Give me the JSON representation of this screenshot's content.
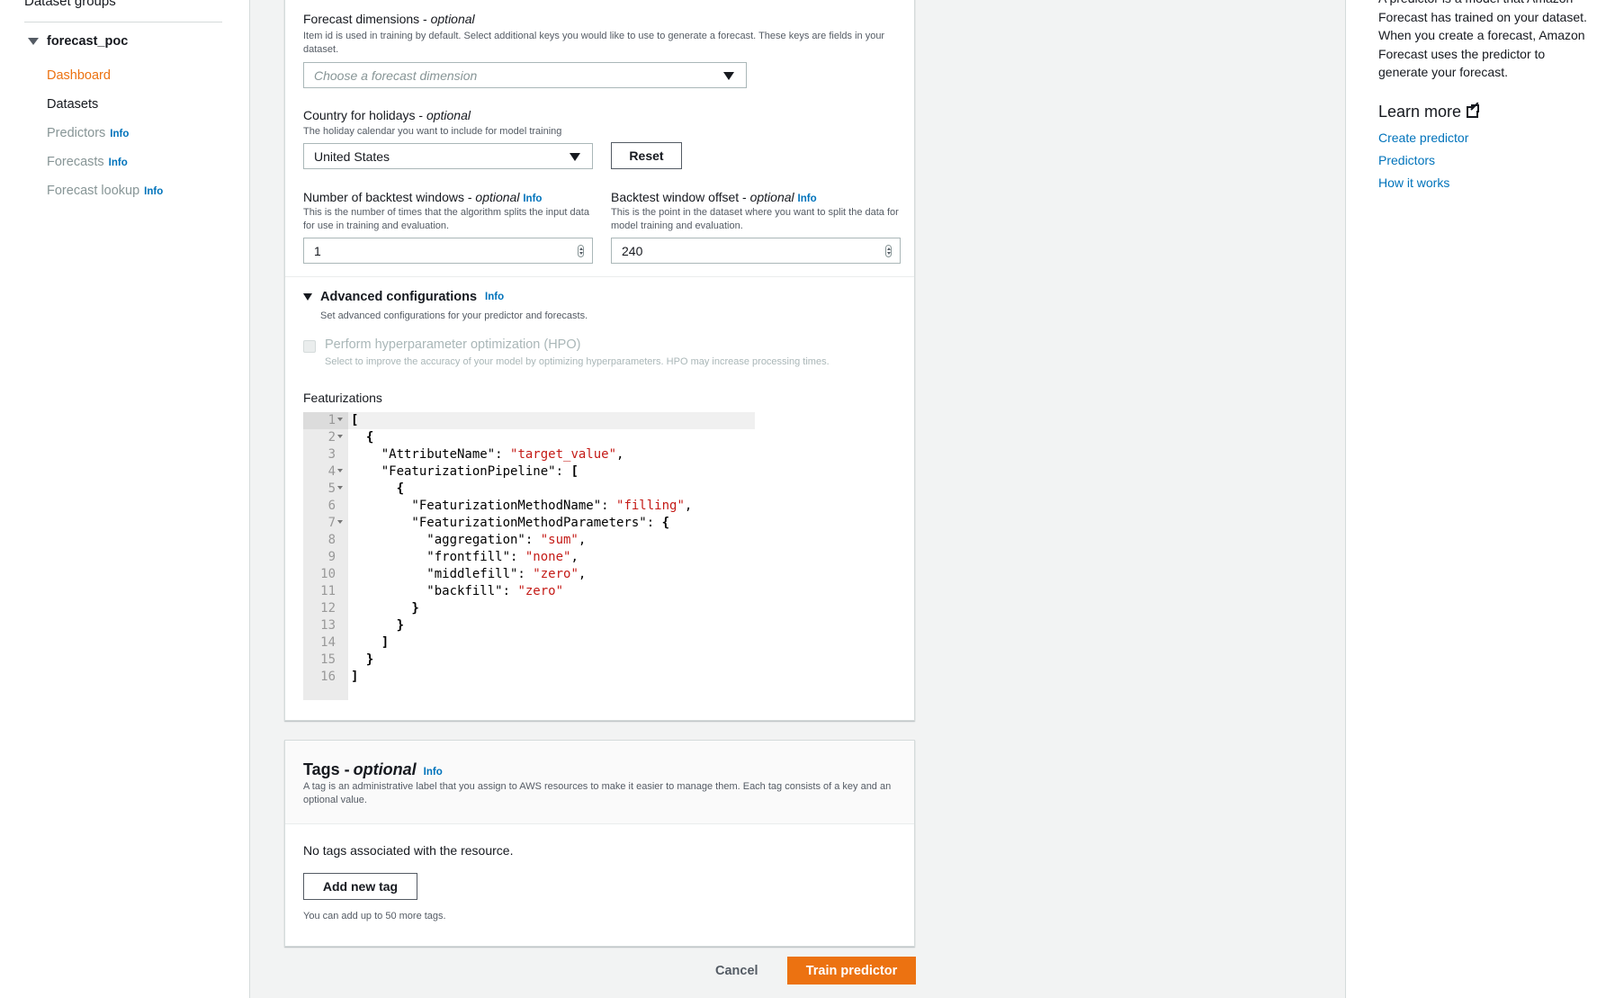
{
  "nav": {
    "heading": "Dataset groups",
    "group_label": "forecast_poc",
    "items": [
      {
        "label": "Dashboard"
      },
      {
        "label": "Datasets"
      },
      {
        "label": "Predictors",
        "info": "Info"
      },
      {
        "label": "Forecasts",
        "info": "Info"
      },
      {
        "label": "Forecast lookup",
        "info": "Info"
      }
    ]
  },
  "form": {
    "dimensions": {
      "label": "Forecast dimensions - ",
      "optional": "optional",
      "description": "Item id is used in training by default. Select additional keys you would like to use to generate a forecast. These keys are fields in your dataset.",
      "placeholder": "Choose a forecast dimension"
    },
    "holidays": {
      "label": "Country for holidays - ",
      "optional": "optional",
      "description": "The holiday calendar you want to include for model training",
      "value": "United States",
      "reset_label": "Reset"
    },
    "backtest_windows": {
      "label": "Number of backtest windows - ",
      "optional": "optional",
      "info": "Info",
      "description": "This is the number of times that the algorithm splits the input data for use in training and evaluation.",
      "value": "1"
    },
    "backtest_offset": {
      "label": "Backtest window offset - ",
      "optional": "optional",
      "info": "Info",
      "description": "This is the point in the dataset where you want to split the data for model training and evaluation.",
      "value": "240"
    },
    "advanced": {
      "title": "Advanced configurations",
      "info": "Info",
      "description": "Set advanced configurations for your predictor and forecasts.",
      "hpo_label": "Perform hyperparameter optimization (HPO)",
      "hpo_description": "Select to improve the accuracy of your model by optimizing hyperparameters. HPO may increase processing times."
    },
    "featurizations": {
      "label": "Featurizations",
      "lines": [
        {
          "n": "1",
          "fold": true,
          "parts": [
            {
              "t": "p",
              "v": "["
            }
          ]
        },
        {
          "n": "2",
          "fold": true,
          "parts": [
            {
              "t": "p",
              "v": "  {"
            }
          ]
        },
        {
          "n": "3",
          "fold": false,
          "parts": [
            {
              "t": "k",
              "v": "    \"AttributeName\": "
            },
            {
              "t": "s",
              "v": "\"target_value\""
            },
            {
              "t": "k",
              "v": ","
            }
          ]
        },
        {
          "n": "4",
          "fold": true,
          "parts": [
            {
              "t": "k",
              "v": "    \"FeaturizationPipeline\": "
            },
            {
              "t": "p",
              "v": "["
            }
          ]
        },
        {
          "n": "5",
          "fold": true,
          "parts": [
            {
              "t": "p",
              "v": "      {"
            }
          ]
        },
        {
          "n": "6",
          "fold": false,
          "parts": [
            {
              "t": "k",
              "v": "        \"FeaturizationMethodName\": "
            },
            {
              "t": "s",
              "v": "\"filling\""
            },
            {
              "t": "k",
              "v": ","
            }
          ]
        },
        {
          "n": "7",
          "fold": true,
          "parts": [
            {
              "t": "k",
              "v": "        \"FeaturizationMethodParameters\": "
            },
            {
              "t": "p",
              "v": "{"
            }
          ]
        },
        {
          "n": "8",
          "fold": false,
          "parts": [
            {
              "t": "k",
              "v": "          \"aggregation\": "
            },
            {
              "t": "s",
              "v": "\"sum\""
            },
            {
              "t": "k",
              "v": ","
            }
          ]
        },
        {
          "n": "9",
          "fold": false,
          "parts": [
            {
              "t": "k",
              "v": "          \"frontfill\": "
            },
            {
              "t": "s",
              "v": "\"none\""
            },
            {
              "t": "k",
              "v": ","
            }
          ]
        },
        {
          "n": "10",
          "fold": false,
          "parts": [
            {
              "t": "k",
              "v": "          \"middlefill\": "
            },
            {
              "t": "s",
              "v": "\"zero\""
            },
            {
              "t": "k",
              "v": ","
            }
          ]
        },
        {
          "n": "11",
          "fold": false,
          "parts": [
            {
              "t": "k",
              "v": "          \"backfill\": "
            },
            {
              "t": "s",
              "v": "\"zero\""
            }
          ]
        },
        {
          "n": "12",
          "fold": false,
          "parts": [
            {
              "t": "p",
              "v": "        }"
            }
          ]
        },
        {
          "n": "13",
          "fold": false,
          "parts": [
            {
              "t": "p",
              "v": "      }"
            }
          ]
        },
        {
          "n": "14",
          "fold": false,
          "parts": [
            {
              "t": "p",
              "v": "    ]"
            }
          ]
        },
        {
          "n": "15",
          "fold": false,
          "parts": [
            {
              "t": "p",
              "v": "  }"
            }
          ]
        },
        {
          "n": "16",
          "fold": false,
          "parts": [
            {
              "t": "p",
              "v": "]"
            }
          ]
        }
      ]
    }
  },
  "tags": {
    "title": "Tags - ",
    "optional": "optional",
    "info": "Info",
    "description": "A tag is an administrative label that you assign to AWS resources to make it easier to manage them. Each tag consists of a key and an optional value.",
    "empty": "No tags associated with the resource.",
    "add_label": "Add new tag",
    "limit": "You can add up to 50 more tags."
  },
  "footer": {
    "cancel": "Cancel",
    "submit": "Train predictor"
  },
  "help": {
    "text": "A predictor is a model that Amazon Forecast has trained on your dataset. When you create a forecast, Amazon Forecast uses the predictor to generate your forecast.",
    "learn_more": "Learn more",
    "links": [
      "Create predictor",
      "Predictors",
      "How it works"
    ]
  }
}
